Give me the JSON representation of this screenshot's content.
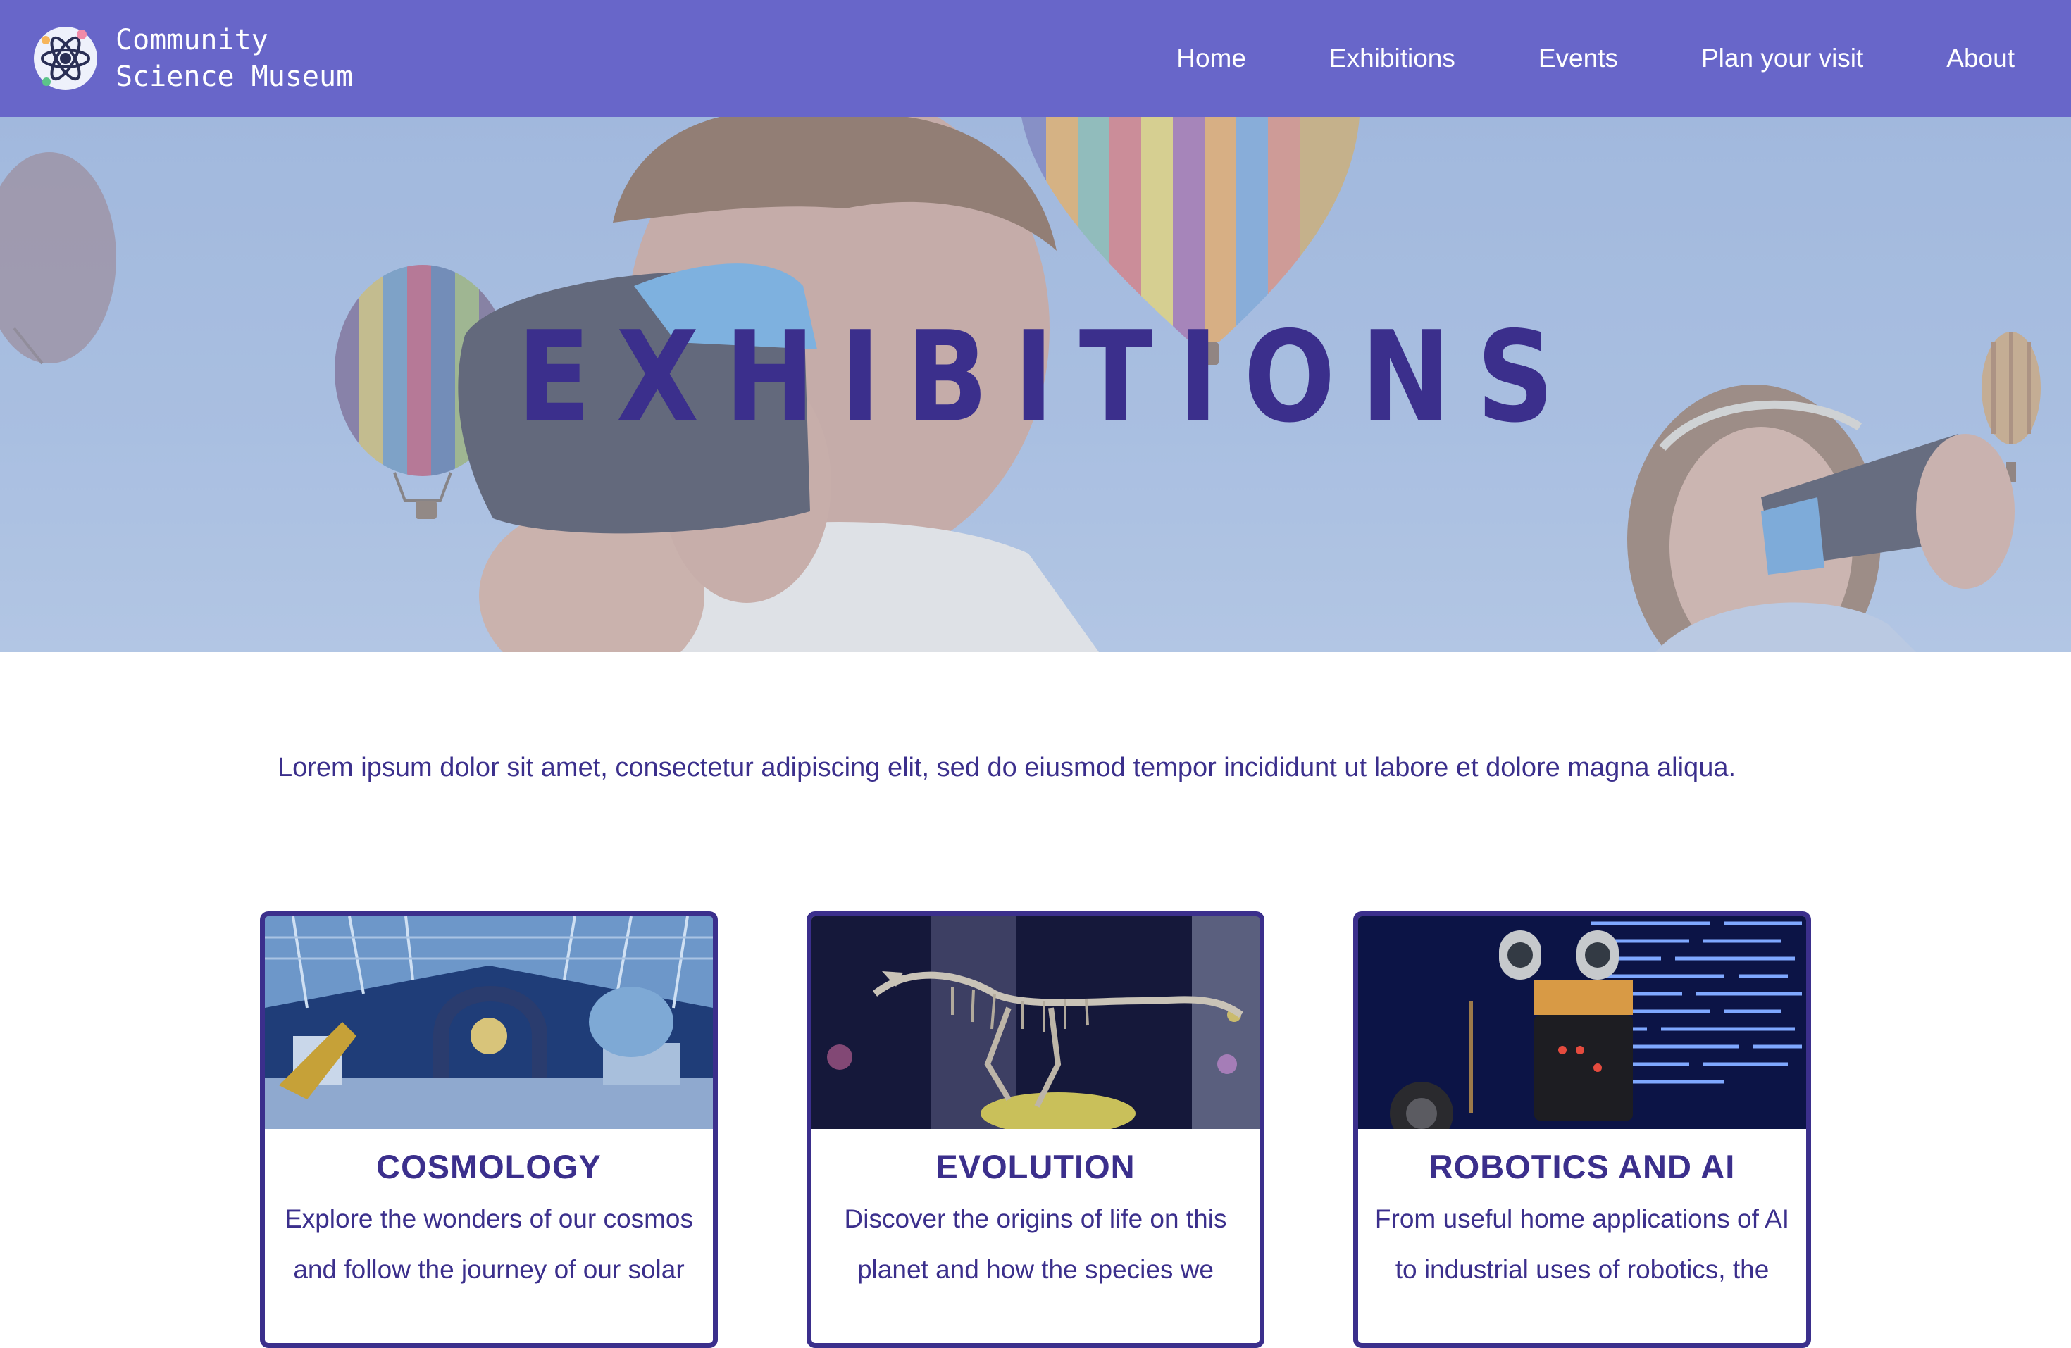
{
  "brand": {
    "name_line1": "Community",
    "name_line2": "Science Museum",
    "logo_icon": "atom-icon"
  },
  "nav": {
    "items": [
      {
        "label": "Home"
      },
      {
        "label": "Exhibitions"
      },
      {
        "label": "Events"
      },
      {
        "label": "Plan your visit"
      },
      {
        "label": "About"
      }
    ]
  },
  "hero": {
    "title": "EXHIBITIONS",
    "image": "children-with-vr-headsets-and-hot-air-balloons"
  },
  "intro": {
    "text": "Lorem ipsum dolor sit amet, consectetur adipiscing elit, sed do eiusmod tempor incididunt ut labore et dolore magna aliqua."
  },
  "cards": [
    {
      "title": "COSMOLOGY",
      "text": "Explore the wonders of our cosmos and follow the journey of our solar",
      "image": "science-hall-interior"
    },
    {
      "title": "EVOLUTION",
      "text": "Discover the origins of life on this planet and how the species we",
      "image": "dinosaur-skeleton"
    },
    {
      "title": "ROBOTICS AND AI",
      "text": "From useful home applications of AI to industrial uses of robotics, the",
      "image": "robot-and-code-screen"
    }
  ],
  "colors": {
    "header_bg": "#6866c9",
    "accent": "#3b2f8c",
    "nav_text": "#ffffff"
  }
}
